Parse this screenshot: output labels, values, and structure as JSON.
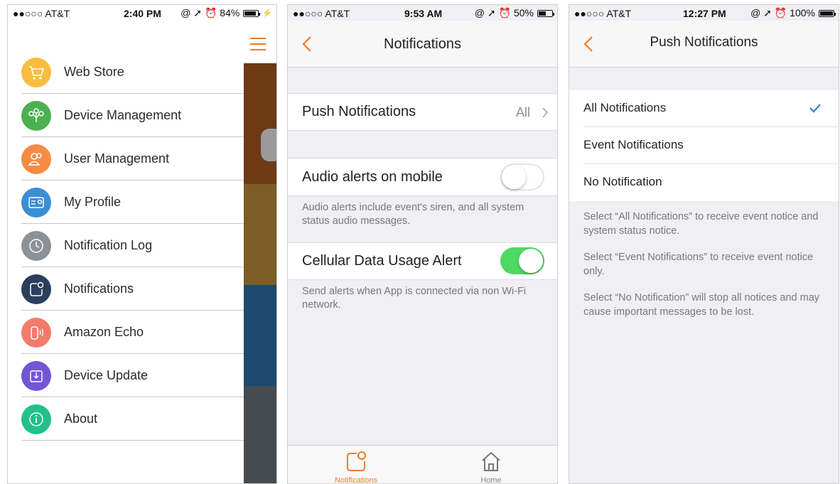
{
  "colors": {
    "accent": "#f07b28",
    "toggle_on": "#4cd964",
    "check": "#2b7fd1",
    "strip": [
      "#6e3a16",
      "#7d5c25",
      "#1d4a6e",
      "#464b50"
    ]
  },
  "screens": [
    {
      "status": {
        "carrier": "●●○○○ AT&T",
        "time": "2:40 PM",
        "right": "@ ➚ ⏰ 84%",
        "battery": 0.84
      },
      "menu": [
        {
          "label": "Web Store",
          "icon": "cart-icon",
          "color": "#f9bd41"
        },
        {
          "label": "Device Management",
          "icon": "device-tree-icon",
          "color": "#4caf50"
        },
        {
          "label": "User Management",
          "icon": "users-icon",
          "color": "#f48c46"
        },
        {
          "label": "My Profile",
          "icon": "id-card-icon",
          "color": "#3b8ed5"
        },
        {
          "label": "Notification Log",
          "icon": "history-icon",
          "color": "#8c9196"
        },
        {
          "label": "Notifications",
          "icon": "notification-icon",
          "color": "#2a3f5c"
        },
        {
          "label": "Amazon Echo",
          "icon": "echo-icon",
          "color": "#f27b6b"
        },
        {
          "label": "Device Update",
          "icon": "update-icon",
          "color": "#7256d6"
        },
        {
          "label": "About",
          "icon": "info-icon",
          "color": "#23c08a"
        }
      ]
    },
    {
      "status": {
        "carrier": "●●○○○ AT&T",
        "time": "9:53 AM",
        "right": "@ ➚ ⏰ 50%",
        "battery": 0.5
      },
      "title": "Notifications",
      "push_label": "Push Notifications",
      "push_value": "All",
      "audio_label": "Audio alerts on mobile",
      "audio_on": false,
      "audio_note": "Audio alerts include event's siren, and all system status audio messages.",
      "cellular_label": "Cellular Data Usage Alert",
      "cellular_on": true,
      "cellular_note": "Send alerts when App is connected via non Wi-Fi network.",
      "tabs": [
        {
          "label": "Notifications",
          "icon": "notification-icon",
          "active": true
        },
        {
          "label": "Home",
          "icon": "home-icon",
          "active": false
        }
      ]
    },
    {
      "status": {
        "carrier": "●●○○○ AT&T",
        "time": "12:27 PM",
        "right": "@ ➚ ⏰ 100%",
        "battery": 1.0
      },
      "title": "Push Notifications",
      "options": [
        {
          "label": "All Notifications",
          "selected": true
        },
        {
          "label": "Event Notifications",
          "selected": false
        },
        {
          "label": "No Notification",
          "selected": false
        }
      ],
      "descriptions": [
        "Select “All Notifications” to receive event notice and system status notice.",
        "Select “Event Notifications” to receive event notice only.",
        "Select “No Notification” will stop all notices and may cause important messages to be lost."
      ]
    }
  ]
}
